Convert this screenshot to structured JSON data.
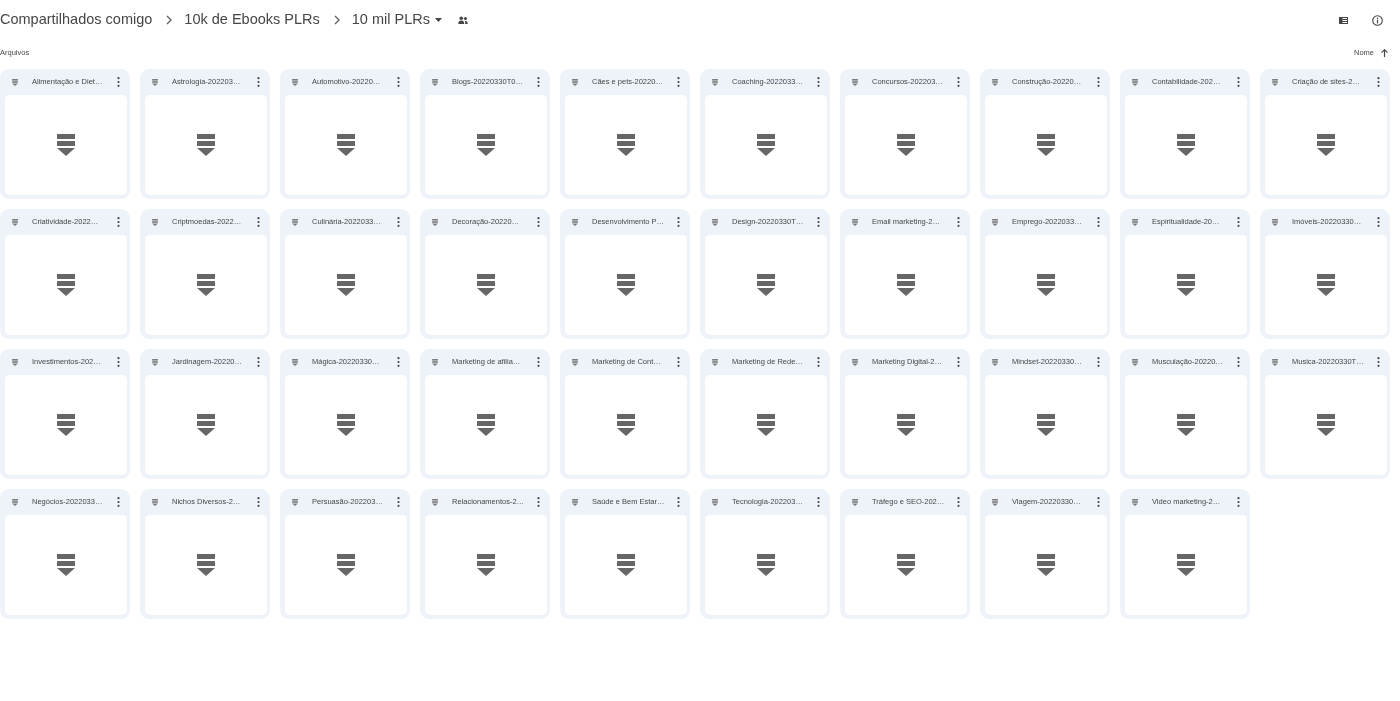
{
  "breadcrumb": [
    {
      "label": "Compartilhados comigo",
      "kind": "link"
    },
    {
      "label": "10k de Ebooks PLRs",
      "kind": "link"
    },
    {
      "label": "10 mil PLRs",
      "kind": "current"
    }
  ],
  "section": {
    "title": "Arquivos",
    "sort_label": "Nome"
  },
  "files": [
    {
      "name": "Alimentação e Diet…"
    },
    {
      "name": "Astrologia-202203…"
    },
    {
      "name": "Automotivo-20220…"
    },
    {
      "name": "Blogs-20220330T0…"
    },
    {
      "name": "Cães e pets-20220…"
    },
    {
      "name": "Coaching-2022033…"
    },
    {
      "name": "Concursos-202203…"
    },
    {
      "name": "Construção-20220…"
    },
    {
      "name": "Contabilidade-202…"
    },
    {
      "name": "Criação de sites-2…"
    },
    {
      "name": "Criatividade-2022…"
    },
    {
      "name": "Criptmoedas-2022…"
    },
    {
      "name": "Culinária-2022033…"
    },
    {
      "name": "Decoração-20220…"
    },
    {
      "name": "Desenvolvimento P…"
    },
    {
      "name": "Design-20220330T…"
    },
    {
      "name": "Email marketing-2…"
    },
    {
      "name": "Emprego-2022033…"
    },
    {
      "name": "Espiritualidade-20…"
    },
    {
      "name": "Imóveis-20220330…"
    },
    {
      "name": "Investimentos-202…"
    },
    {
      "name": "Jardinagem-20220…"
    },
    {
      "name": "Mágica-20220330…"
    },
    {
      "name": "Marketing de afilia…"
    },
    {
      "name": "Marketing de Cont…"
    },
    {
      "name": "Marketing de Rede…"
    },
    {
      "name": "Marketing Digital-2…"
    },
    {
      "name": "Mindset-20220330…"
    },
    {
      "name": "Musculação-20220…"
    },
    {
      "name": "Musica-20220330T…"
    },
    {
      "name": "Negócios-2022033…"
    },
    {
      "name": "Nichos Diversos-2…"
    },
    {
      "name": "Persuasão-202203…"
    },
    {
      "name": "Relacionamentos-2…"
    },
    {
      "name": "Saúde e Bem Estar…"
    },
    {
      "name": "Tecnologia-202203…"
    },
    {
      "name": "Tráfego e SEO-202…"
    },
    {
      "name": "Viagem-20220330…"
    },
    {
      "name": "Video marketing-2…"
    }
  ]
}
